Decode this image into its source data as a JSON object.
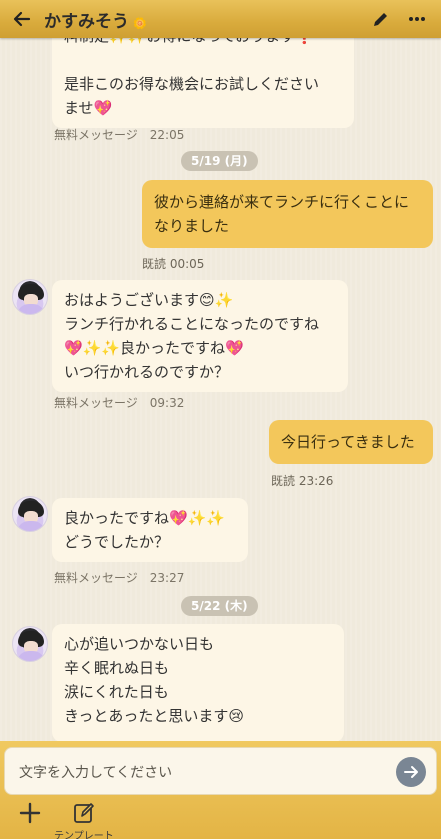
{
  "header": {
    "title": "かすみそう",
    "title_deco": "🌼"
  },
  "messages": [
    {
      "id": "m1",
      "dir": "in",
      "text": "料制定✨✨お得になっております❗\n\n是非このお得な機会にお試しください\nませ💖",
      "meta": "無料メッセージ　22:05"
    },
    {
      "id": "d1",
      "date": "5/19 (月)"
    },
    {
      "id": "m2",
      "dir": "out",
      "text": "彼から連絡が来てランチに行くことに\nなりました",
      "meta": "既読 00:05"
    },
    {
      "id": "m3",
      "dir": "in",
      "text": "おはようございます😊✨\nランチ行かれることになったのですね\n💖✨✨良かったですね💖\nいつ行かれるのですか？",
      "meta": "無料メッセージ　09:32"
    },
    {
      "id": "m4",
      "dir": "out",
      "text": "今日行ってきました",
      "meta": "既読 23:26"
    },
    {
      "id": "m5",
      "dir": "in",
      "text": "良かったですね💖✨✨\nどうでしたか？",
      "meta": "無料メッセージ　23:27"
    },
    {
      "id": "d2",
      "date": "5/22 (木)"
    },
    {
      "id": "m6",
      "dir": "in",
      "text": "心が追いつかない日も\n辛く眠れぬ日も\n涙にくれた日も\nきっとあったと思います😢",
      "meta": ""
    }
  ],
  "composer": {
    "placeholder": "文字を入力してください",
    "tools": [
      {
        "label": "",
        "icon": "plus-icon"
      },
      {
        "label": "テンプレート",
        "icon": "edit-template-icon"
      }
    ]
  },
  "colors": {
    "header": "#d9ab3c",
    "bubble_out": "#f3c75b",
    "bubble_in": "#fdf6e6",
    "background": "#f0eadc"
  }
}
